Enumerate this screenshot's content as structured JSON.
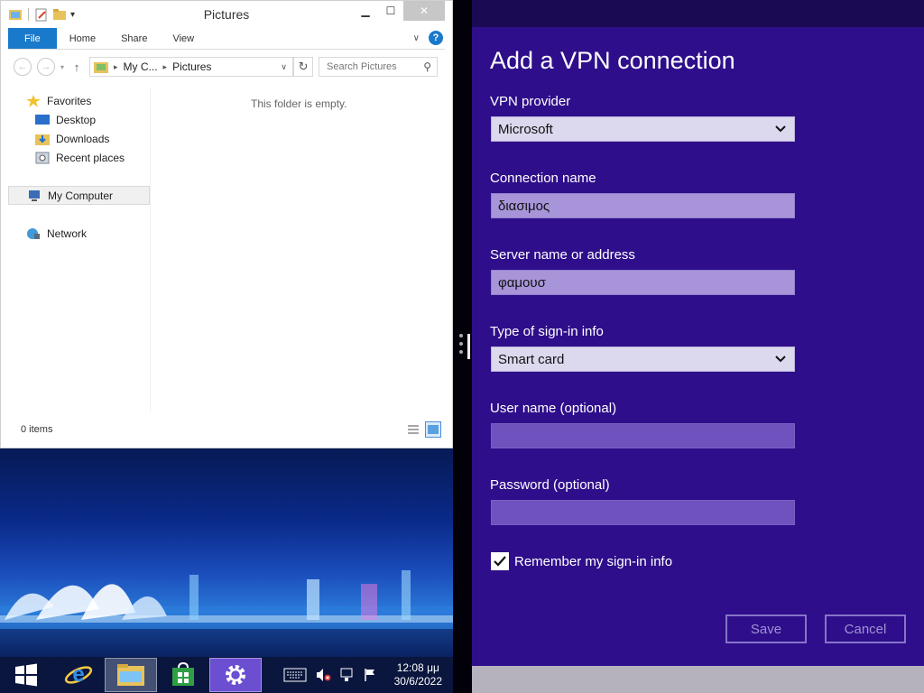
{
  "explorer": {
    "title": "Pictures",
    "ribbon_tabs": [
      "File",
      "Home",
      "Share",
      "View"
    ],
    "address": {
      "segment1": "My C...",
      "segment2": "Pictures"
    },
    "search_placeholder": "Search Pictures",
    "nav": {
      "favorites": "Favorites",
      "desktop": "Desktop",
      "downloads": "Downloads",
      "recent": "Recent places",
      "computer": "My Computer",
      "network": "Network"
    },
    "empty_message": "This folder is empty.",
    "status": "0 items"
  },
  "vpn": {
    "title": "Add a VPN connection",
    "provider_label": "VPN provider",
    "provider_value": "Microsoft",
    "conn_name_label": "Connection name",
    "conn_name_value": "διασιμος",
    "server_label": "Server name or address",
    "server_value": "φαμουσ",
    "signin_type_label": "Type of sign-in info",
    "signin_type_value": "Smart card",
    "username_label": "User name (optional)",
    "username_value": "",
    "password_label": "Password (optional)",
    "password_value": "",
    "remember_label": "Remember my sign-in info",
    "remember_checked": true,
    "save_label": "Save",
    "cancel_label": "Cancel"
  },
  "taskbar": {
    "time": "12:08 μμ",
    "date": "30/6/2022",
    "pinned": [
      "windows-start-icon",
      "internet-explorer-icon",
      "file-explorer-icon",
      "store-icon",
      "settings-icon"
    ]
  },
  "colors": {
    "vpn_background": "#2e0e8a",
    "file_tab": "#1979ca",
    "button_border": "#8575c8"
  }
}
